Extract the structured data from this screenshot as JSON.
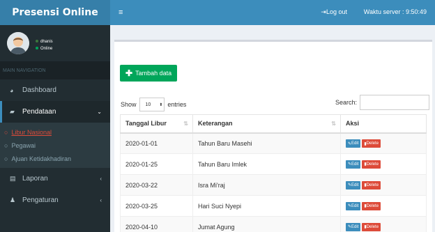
{
  "header": {
    "app_title": "Presensi Online",
    "menu_toggle": "≡",
    "logout_label": "Log out",
    "server_time": "Waktu server : 9:50:49"
  },
  "user": {
    "name": "dhanis",
    "status": "Online"
  },
  "sidebar": {
    "nav_header": "MAIN NAVIGATION",
    "items": [
      {
        "label": "Dashboard",
        "icon": "dashboard-icon"
      },
      {
        "label": "Pendataan",
        "icon": "book-icon"
      },
      {
        "label": "Laporan",
        "icon": "report-icon"
      },
      {
        "label": "Pengaturan",
        "icon": "user-icon"
      }
    ],
    "submenu": [
      {
        "label": "Libur Nasional"
      },
      {
        "label": "Pegawai"
      },
      {
        "label": "Ajuan Ketidakhadiran"
      }
    ]
  },
  "toolbar": {
    "add_label": "Tambah data"
  },
  "table_controls": {
    "show_label": "Show",
    "entries_value": "10",
    "entries_label": "entries",
    "search_label": "Search:"
  },
  "table": {
    "headers": [
      "Tanggal Libur",
      "Keterangan",
      "Aksi"
    ],
    "rows": [
      {
        "date": "2020-01-01",
        "desc": "Tahun Baru Masehi"
      },
      {
        "date": "2020-01-25",
        "desc": "Tahun Baru Imlek"
      },
      {
        "date": "2020-03-22",
        "desc": "Isra Mi'raj"
      },
      {
        "date": "2020-03-25",
        "desc": "Hari Suci Nyepi"
      },
      {
        "date": "2020-04-10",
        "desc": "Jumat Agung"
      }
    ],
    "edit_label": "Edit",
    "delete_label": "Delete"
  },
  "colors": {
    "header": "#3c8dbc",
    "logo": "#367fa9",
    "sidebar": "#222d32",
    "success": "#00a65a",
    "danger": "#dd4b39"
  }
}
